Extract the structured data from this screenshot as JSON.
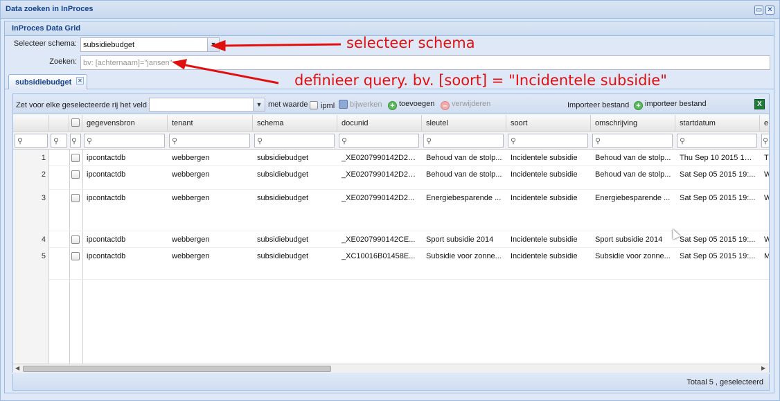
{
  "window": {
    "title": "Data zoeken in InProces",
    "max_icon": "maximize-icon",
    "close_icon": "close-icon"
  },
  "panel": {
    "title": "InProces Data Grid"
  },
  "form": {
    "schema_label": "Selecteer schema:",
    "schema_value": "subsidiebudget",
    "search_label": "Zoeken:",
    "search_placeholder": "bv: [achternaam]=\"jansen\""
  },
  "annotations": {
    "schema_note": "selecteer schema",
    "query_note": "definieer query. bv. [soort] = \"Incidentele subsidie\""
  },
  "tab": {
    "label": "subsidiebudget"
  },
  "toolbar": {
    "set_field_label": "Zet voor elke geselecteerde rij het veld",
    "field_value": "",
    "with_value_label": "met waarde",
    "ipml_label": "ipml",
    "update_label": "bijwerken",
    "add_label": "toevoegen",
    "delete_label": "verwijderen",
    "import_label": "Importeer bestand",
    "import_button_label": "importeer bestand",
    "excel_icon": "excel-export-icon"
  },
  "grid": {
    "columns": [
      "gegevensbron",
      "tenant",
      "schema",
      "docunid",
      "sleutel",
      "soort",
      "omschrijving",
      "startdatum",
      "e"
    ],
    "rows": [
      {
        "num": "1",
        "cells": [
          "ipcontactdb",
          "webbergen",
          "subsidiebudget",
          "_XE0207990142D28...",
          "Behoud van de stolp...",
          "Incidentele subsidie",
          "Behoud van de stolp...",
          "Thu Sep 10 2015 10:...",
          "T"
        ]
      },
      {
        "num": "2",
        "cells": [
          "ipcontactdb",
          "webbergen",
          "subsidiebudget",
          "_XE0207990142D28...",
          "Behoud van de stolp...",
          "Incidentele subsidie",
          "Behoud van de stolp...",
          "Sat Sep 05 2015 19:...",
          "W"
        ]
      },
      {
        "num": "3",
        "cells": [
          "ipcontactdb",
          "webbergen",
          "subsidiebudget",
          "_XE0207990142D2...",
          "Energiebesparende ...",
          "Incidentele subsidie",
          "Energiebesparende ...",
          "Sat Sep 05 2015 19:...",
          "W"
        ]
      },
      {
        "num": "4",
        "cells": [
          "ipcontactdb",
          "webbergen",
          "subsidiebudget",
          "_XE0207990142CE...",
          "Sport subsidie 2014",
          "Incidentele subsidie",
          "Sport subsidie 2014",
          "Sat Sep 05 2015 19:...",
          "W"
        ]
      },
      {
        "num": "5",
        "cells": [
          "ipcontactdb",
          "webbergen",
          "subsidiebudget",
          "_XC10016B01458E...",
          "Subsidie voor zonne...",
          "Incidentele subsidie",
          "Subsidie voor zonne...",
          "Sat Sep 05 2015 19:...",
          "M"
        ]
      }
    ]
  },
  "status": {
    "text": "Totaal 5  , geselecteerd"
  }
}
